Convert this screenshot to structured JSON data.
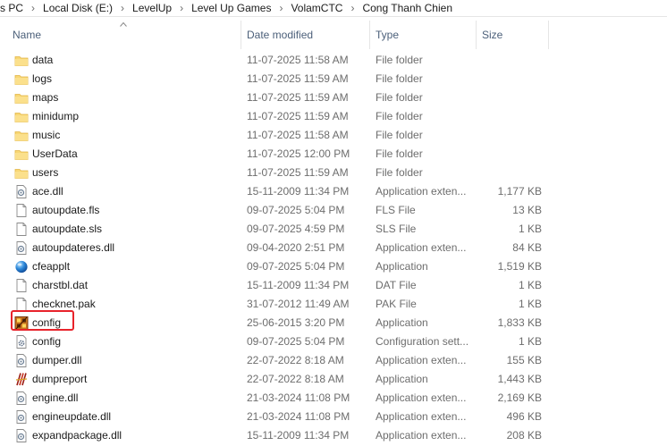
{
  "breadcrumb": [
    "s PC",
    "Local Disk (E:)",
    "LevelUp",
    "Level Up Games",
    "VolamCTC",
    "Cong Thanh Chien"
  ],
  "columns": {
    "name": "Name",
    "date": "Date modified",
    "type": "Type",
    "size": "Size"
  },
  "files": [
    {
      "name": "data",
      "date": "11-07-2025 11:58 AM",
      "type": "File folder",
      "size": "",
      "icon": "folder-icon"
    },
    {
      "name": "logs",
      "date": "11-07-2025 11:59 AM",
      "type": "File folder",
      "size": "",
      "icon": "folder-icon"
    },
    {
      "name": "maps",
      "date": "11-07-2025 11:59 AM",
      "type": "File folder",
      "size": "",
      "icon": "folder-icon"
    },
    {
      "name": "minidump",
      "date": "11-07-2025 11:59 AM",
      "type": "File folder",
      "size": "",
      "icon": "folder-icon"
    },
    {
      "name": "music",
      "date": "11-07-2025 11:58 AM",
      "type": "File folder",
      "size": "",
      "icon": "folder-icon"
    },
    {
      "name": "UserData",
      "date": "11-07-2025 12:00 PM",
      "type": "File folder",
      "size": "",
      "icon": "folder-icon"
    },
    {
      "name": "users",
      "date": "11-07-2025 11:59 AM",
      "type": "File folder",
      "size": "",
      "icon": "folder-icon"
    },
    {
      "name": "ace.dll",
      "date": "15-11-2009 11:34 PM",
      "type": "Application exten...",
      "size": "1,177 KB",
      "icon": "dll-icon"
    },
    {
      "name": "autoupdate.fls",
      "date": "09-07-2025 5:04 PM",
      "type": "FLS File",
      "size": "13 KB",
      "icon": "file-icon"
    },
    {
      "name": "autoupdate.sls",
      "date": "09-07-2025 4:59 PM",
      "type": "SLS File",
      "size": "1 KB",
      "icon": "file-icon"
    },
    {
      "name": "autoupdateres.dll",
      "date": "09-04-2020 2:51 PM",
      "type": "Application exten...",
      "size": "84 KB",
      "icon": "dll-icon"
    },
    {
      "name": "cfeapplt",
      "date": "09-07-2025 5:04 PM",
      "type": "Application",
      "size": "1,519 KB",
      "icon": "globe-app-icon"
    },
    {
      "name": "charstbl.dat",
      "date": "15-11-2009 11:34 PM",
      "type": "DAT File",
      "size": "1 KB",
      "icon": "file-icon"
    },
    {
      "name": "checknet.pak",
      "date": "31-07-2012 11:49 AM",
      "type": "PAK File",
      "size": "1 KB",
      "icon": "file-icon"
    },
    {
      "name": "config",
      "date": "25-06-2015 3:20 PM",
      "type": "Application",
      "size": "1,833 KB",
      "icon": "config-app-icon"
    },
    {
      "name": "config",
      "date": "09-07-2025 5:04 PM",
      "type": "Configuration sett...",
      "size": "1 KB",
      "icon": "settings-file-icon"
    },
    {
      "name": "dumper.dll",
      "date": "22-07-2022 8:18 AM",
      "type": "Application exten...",
      "size": "155 KB",
      "icon": "dll-icon"
    },
    {
      "name": "dumpreport",
      "date": "22-07-2022 8:18 AM",
      "type": "Application",
      "size": "1,443 KB",
      "icon": "dumpreport-app-icon"
    },
    {
      "name": "engine.dll",
      "date": "21-03-2024 11:08 PM",
      "type": "Application exten...",
      "size": "2,169 KB",
      "icon": "dll-icon"
    },
    {
      "name": "engineupdate.dll",
      "date": "21-03-2024 11:08 PM",
      "type": "Application exten...",
      "size": "496 KB",
      "icon": "dll-icon"
    },
    {
      "name": "expandpackage.dll",
      "date": "15-11-2009 11:34 PM",
      "type": "Application exten...",
      "size": "208 KB",
      "icon": "dll-icon"
    }
  ],
  "colors": {
    "header_text": "#4c607a",
    "meta_text": "#6d6d6d",
    "highlight": "#e8232b",
    "folder": "#f8d775"
  }
}
